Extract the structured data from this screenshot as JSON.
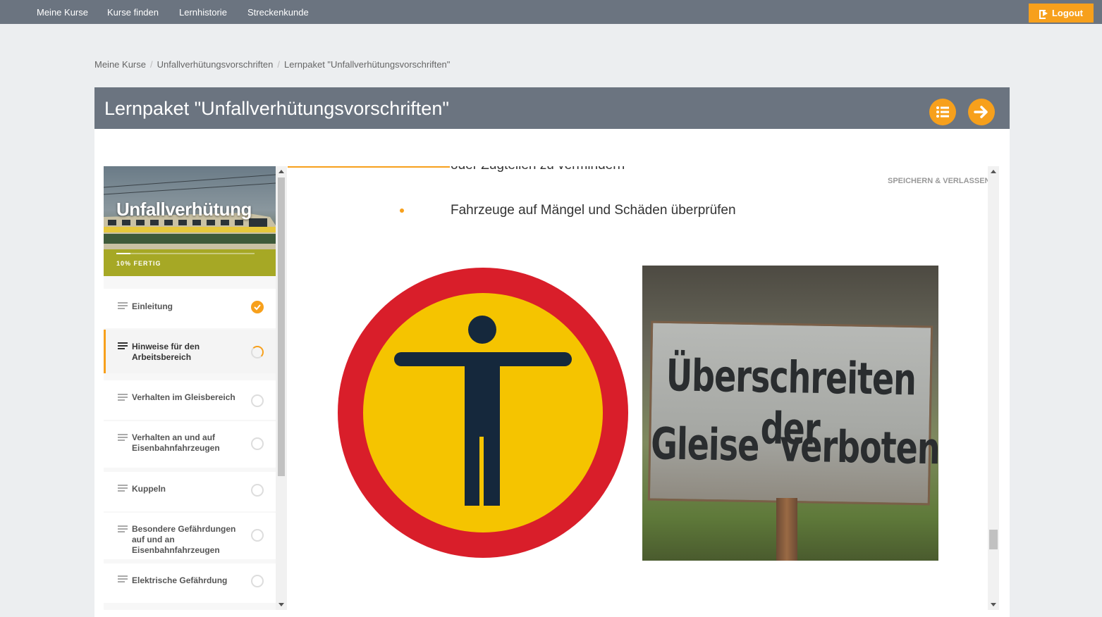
{
  "nav": {
    "items": [
      "Meine Kurse",
      "Kurse finden",
      "Lernhistorie",
      "Streckenkunde"
    ],
    "logout_label": "Logout"
  },
  "breadcrumb": [
    "Meine Kurse",
    "Unfallverhütungsvorschriften",
    "Lernpaket \"Unfallverhütungsvorschriften\""
  ],
  "header": {
    "title": "Lernpaket \"Unfallverhütungsvorschriften\""
  },
  "sidebar": {
    "hero_title": "Unfallverhütung",
    "progress_percent": 10,
    "progress_label": "10% FERTIG",
    "lessons": [
      {
        "label": "Einleitung",
        "status": "done"
      },
      {
        "label": "Hinweise für den Arbeitsbereich",
        "status": "in-progress",
        "active": true
      },
      {
        "label": "Verhalten im Gleisbereich",
        "status": "open"
      },
      {
        "label": "Verhalten an und auf Eisenbahnfahrzeugen",
        "status": "open"
      },
      {
        "label": "Kuppeln",
        "status": "open"
      },
      {
        "label": "Besondere Gefährdungen auf und an Eisenbahnfahrzeugen",
        "status": "open"
      },
      {
        "label": "Elektrische Gefährdung",
        "status": "open"
      }
    ]
  },
  "content": {
    "cut_text": "oder Zugteilen zu vermindern",
    "save_exit": "SPEICHERN & VERLASSEN",
    "bullet": "Fahrzeuge auf Mängel und Schäden überprüfen",
    "photo_sign_line1": "Überschreiten der",
    "photo_sign_line2": "Gleise  verboten"
  },
  "colors": {
    "accent": "#f7a01c",
    "nav_bg": "#6b7480",
    "page_bg": "#eceef0"
  }
}
